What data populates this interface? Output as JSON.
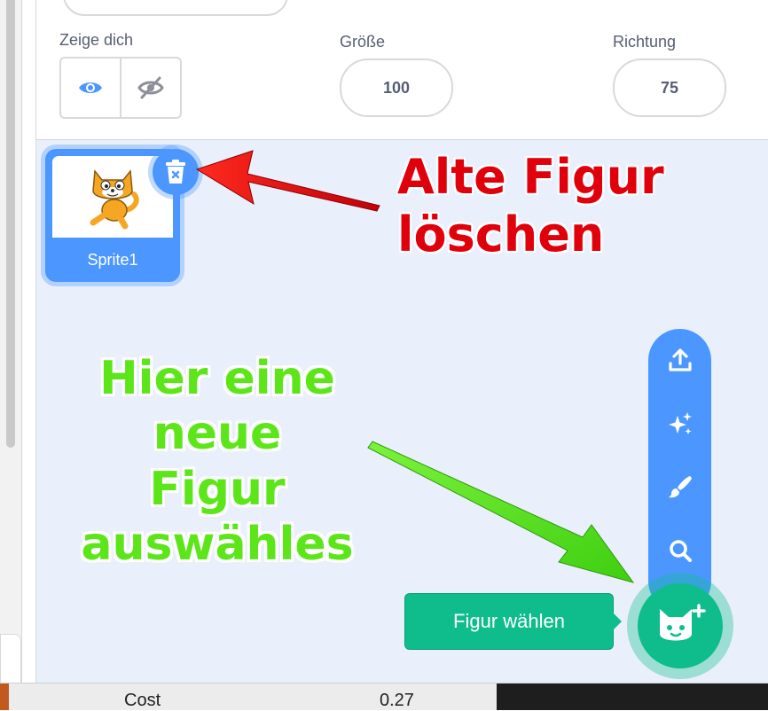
{
  "info_panel": {
    "show_label": "Zeige dich",
    "size_label": "Größe",
    "size_value": "100",
    "direction_label": "Richtung",
    "direction_value": "75"
  },
  "sprite_list": {
    "items": [
      {
        "name": "Sprite1",
        "selected": true
      }
    ]
  },
  "choose_sprite": {
    "tooltip": "Figur wählen",
    "menu_items": [
      "upload-icon",
      "surprise-icon",
      "paint-icon",
      "search-icon"
    ]
  },
  "annotations": {
    "delete_note_line1": "Alte Figur",
    "delete_note_line2": "löschen",
    "choose_note_line1": "Hier eine",
    "choose_note_line2": "neue Figur",
    "choose_note_line3": "auswähles"
  },
  "bottom_bar": {
    "label": "Cost",
    "value": "0.27"
  },
  "colors": {
    "accent_blue": "#4c97ff",
    "accent_green": "#0fbd8c",
    "annotation_red": "#e0000b",
    "annotation_green": "#5ce61a"
  }
}
